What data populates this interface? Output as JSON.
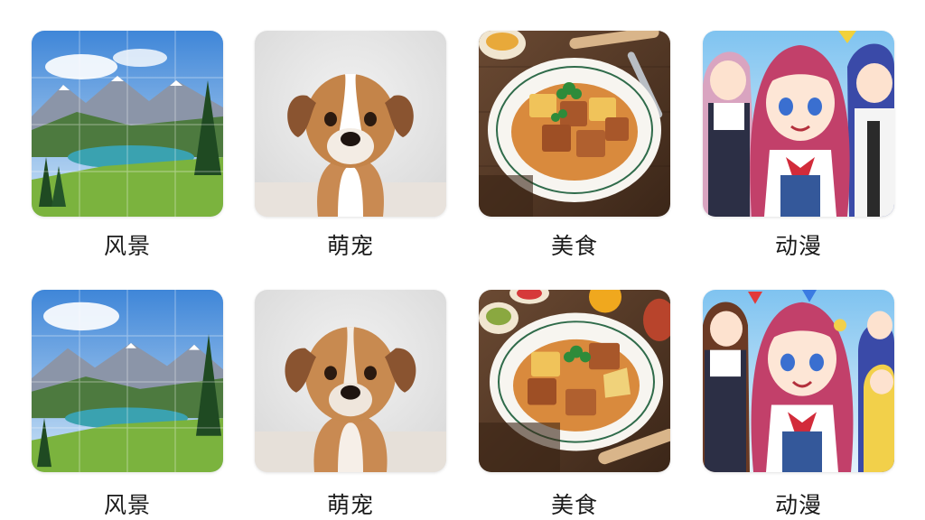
{
  "categories": [
    {
      "label": "风景",
      "image": "mountain-lake-jigsaw-image"
    },
    {
      "label": "萌宠",
      "image": "puppy-image"
    },
    {
      "label": "美食",
      "image": "braised-tofu-dish-image"
    },
    {
      "label": "动漫",
      "image": "anime-girls-image"
    },
    {
      "label": "风景",
      "image": "mountain-lake-jigsaw-image"
    },
    {
      "label": "萌宠",
      "image": "puppy-image"
    },
    {
      "label": "美食",
      "image": "braised-tofu-dish-image"
    },
    {
      "label": "动漫",
      "image": "anime-girls-image"
    }
  ]
}
